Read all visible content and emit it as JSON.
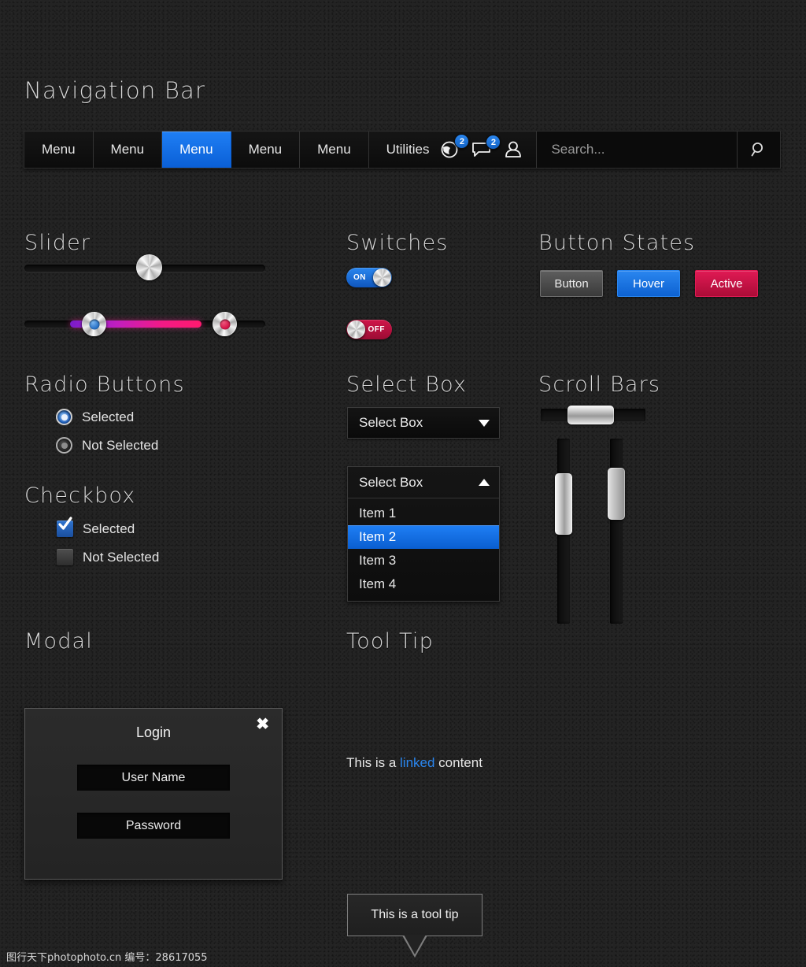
{
  "sections": {
    "navigation": "Navigation Bar",
    "slider": "Slider",
    "switches": "Switches",
    "button_states": "Button States",
    "radio_buttons": "Radio Buttons",
    "select_box": "Select Box",
    "scroll_bars": "Scroll Bars",
    "checkbox": "Checkbox",
    "modal": "Modal",
    "tool_tip": "Tool Tip"
  },
  "navbar": {
    "items": [
      {
        "label": "Menu",
        "active": false
      },
      {
        "label": "Menu",
        "active": false
      },
      {
        "label": "Menu",
        "active": true
      },
      {
        "label": "Menu",
        "active": false
      },
      {
        "label": "Menu",
        "active": false
      }
    ],
    "utilities_label": "Utilities",
    "icons": [
      {
        "name": "globe-icon",
        "badge": "2"
      },
      {
        "name": "message-icon",
        "badge": "2"
      },
      {
        "name": "user-icon",
        "badge": ""
      }
    ],
    "search_placeholder": "Search...",
    "search_value": "",
    "search_button_icon": "search-icon",
    "active_color": "#1f7ff5",
    "badge_color": "#2a86ef"
  },
  "slider": {
    "single": {
      "value_percent": 42
    },
    "range": {
      "start_percent": 19,
      "end_percent": 73,
      "start_color": "#3b86d8",
      "end_color": "#d8174b",
      "fill_from": "#7a1cc9",
      "fill_to": "#ff1a6e"
    }
  },
  "switches": [
    {
      "label": "ON",
      "state": "on",
      "color": "#2a86ef"
    },
    {
      "label": "OFF",
      "state": "off",
      "color": "#d0164a"
    }
  ],
  "buttons": [
    {
      "label": "Button",
      "state": "normal",
      "color": "#5e5e5e"
    },
    {
      "label": "Hover",
      "state": "hover",
      "color": "#2a86ef"
    },
    {
      "label": "Active",
      "state": "active",
      "color": "#e01a54"
    }
  ],
  "radio_options": [
    {
      "label": "Selected",
      "selected": true
    },
    {
      "label": "Not Selected",
      "selected": false
    }
  ],
  "checkbox_options": [
    {
      "label": "Selected",
      "checked": true
    },
    {
      "label": "Not Selected",
      "checked": false
    }
  ],
  "select": {
    "closed_label": "Select Box",
    "open_label": "Select Box",
    "items": [
      {
        "label": "Item 1",
        "selected": false
      },
      {
        "label": "Item 2",
        "selected": true
      },
      {
        "label": "Item 3",
        "selected": false
      },
      {
        "label": "Item 4",
        "selected": false
      }
    ]
  },
  "scrollbars": {
    "horizontal": {
      "thumb_position_percent": 26,
      "thumb_size_percent": 44
    },
    "vertical_left": {
      "thumb_position_percent": 19,
      "thumb_size_percent": 33
    },
    "vertical_right": {
      "thumb_position_percent": 8,
      "thumb_size_percent": 28
    }
  },
  "modal": {
    "title": "Login",
    "close_icon": "close-icon",
    "fields": [
      {
        "placeholder": "User Name",
        "value": ""
      },
      {
        "placeholder": "Password",
        "value": ""
      }
    ]
  },
  "tooltip": {
    "text": "This is a tool tip",
    "caption_before": "This is a ",
    "caption_link": "linked",
    "caption_after": " content",
    "link_color": "#2a86ef"
  },
  "watermark": "图行天下photophoto.cn  编号：28617055"
}
